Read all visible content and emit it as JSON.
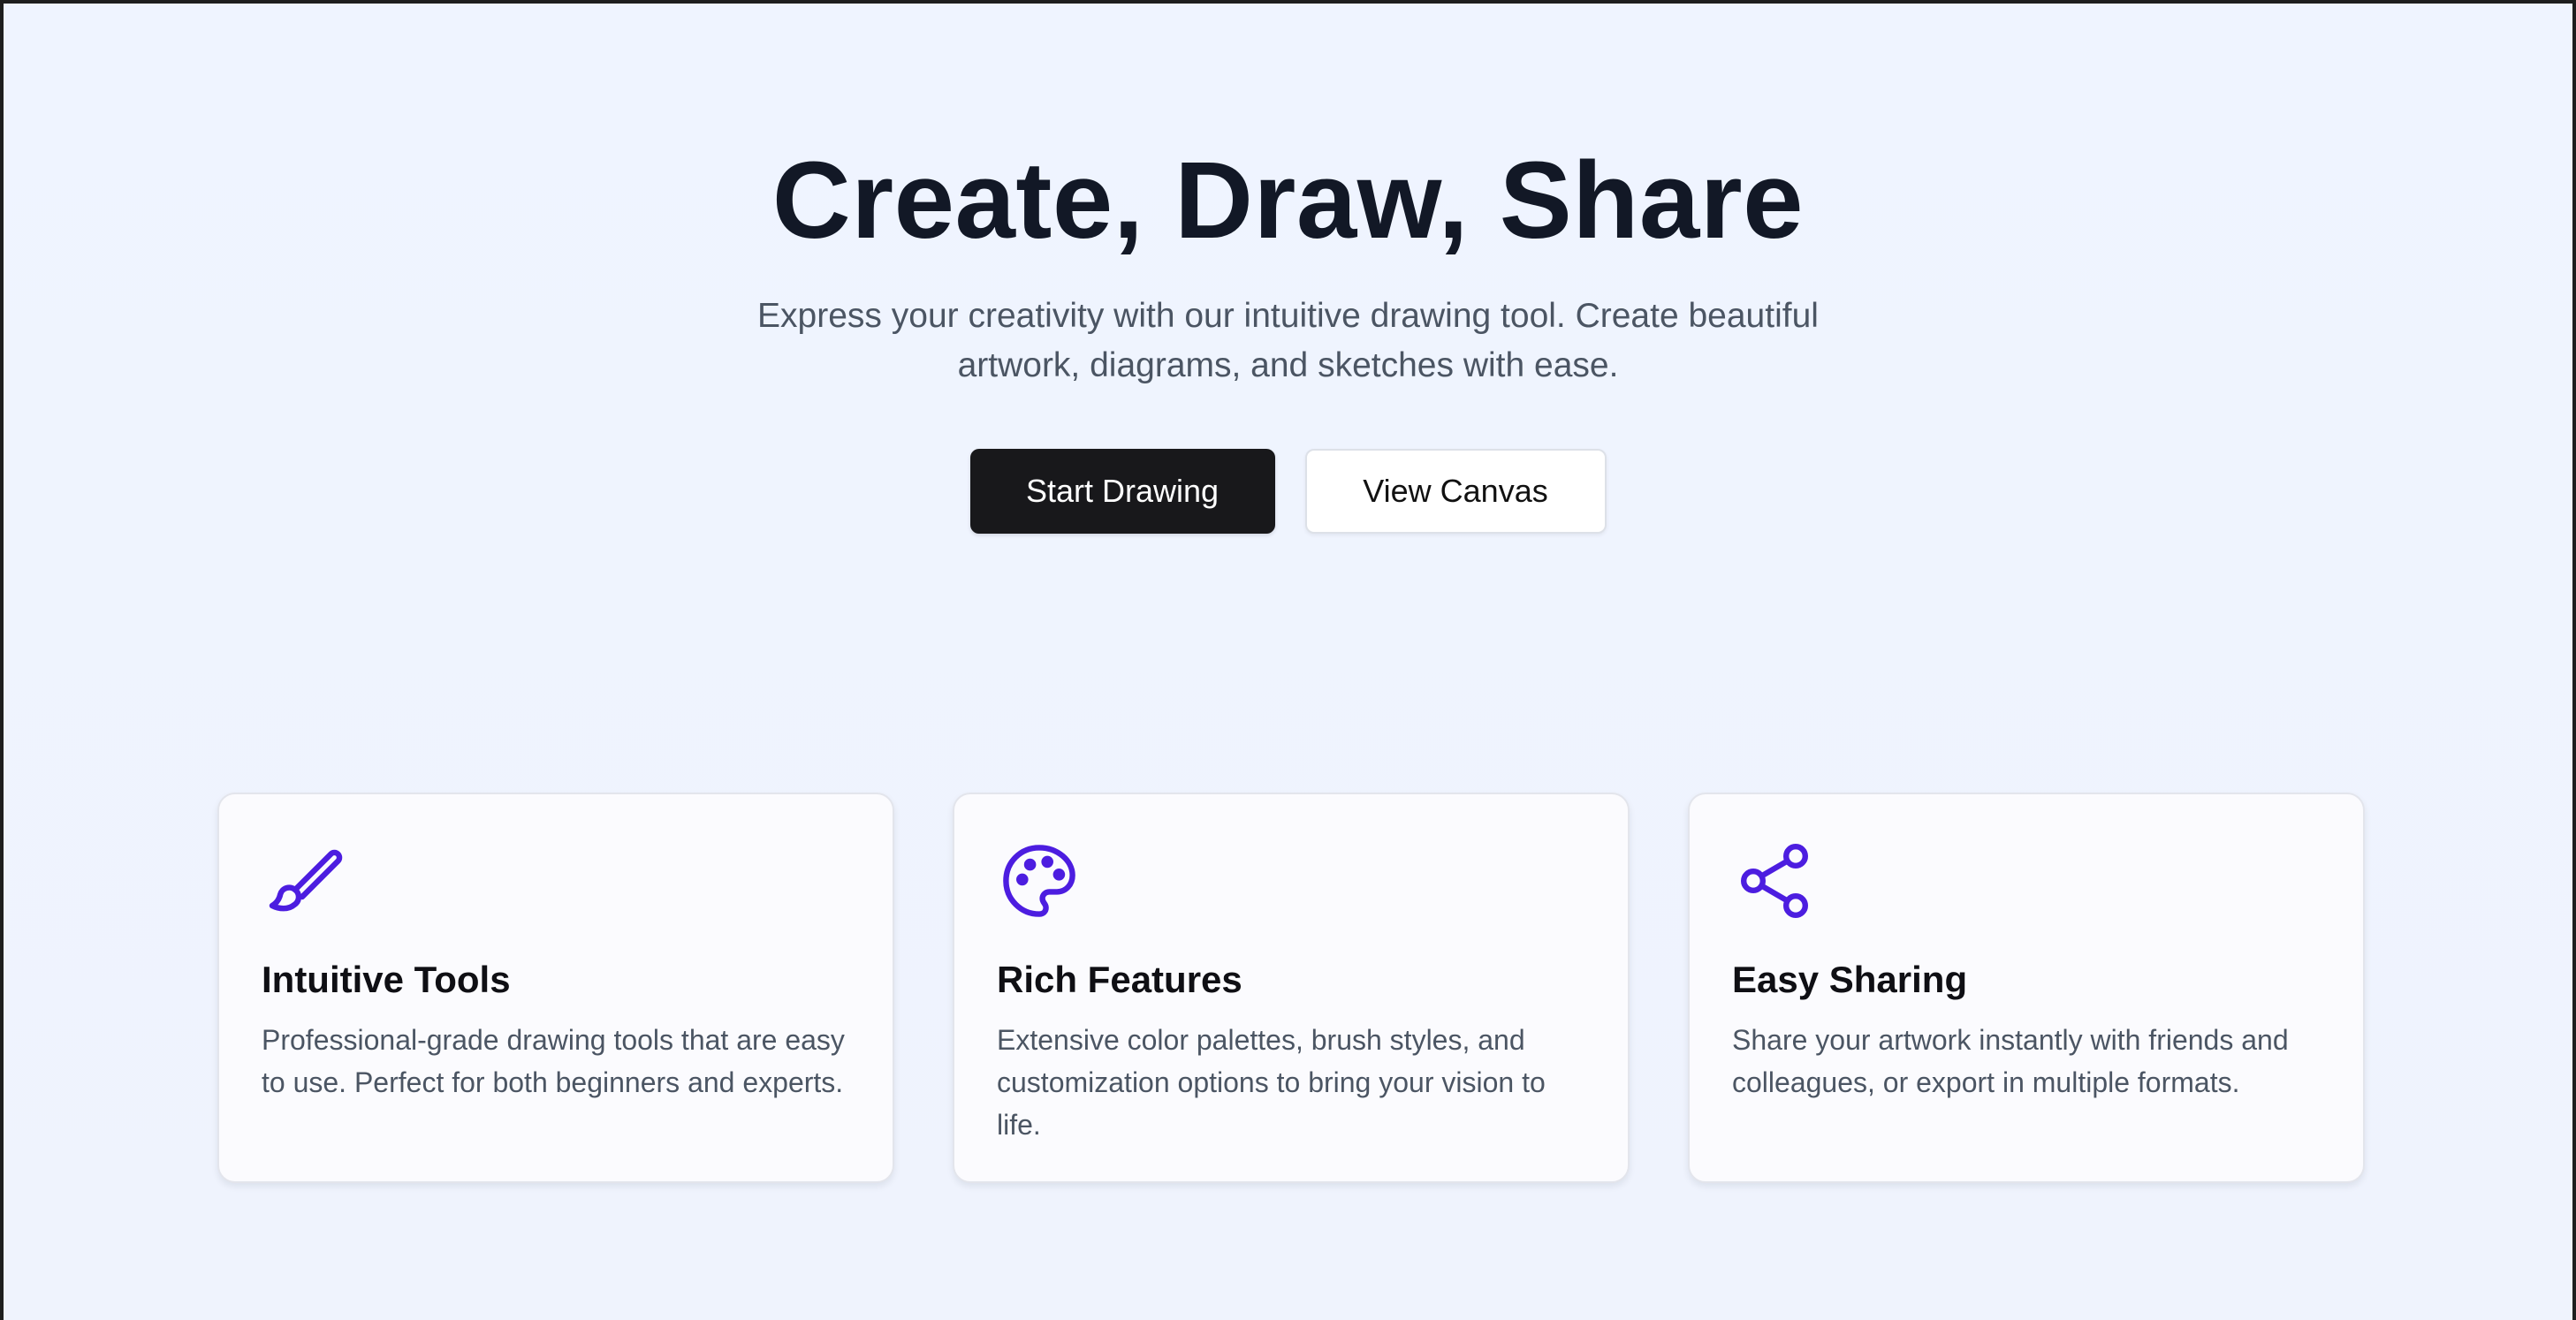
{
  "hero": {
    "title": "Create, Draw, Share",
    "subtitle": "Express your creativity with our intuitive drawing tool. Create beautiful artwork, diagrams, and sketches with ease.",
    "primary_button": "Start Drawing",
    "secondary_button": "View Canvas"
  },
  "features": [
    {
      "icon": "brush-icon",
      "title": "Intuitive Tools",
      "description": "Professional-grade drawing tools that are easy to use. Perfect for both beginners and experts."
    },
    {
      "icon": "palette-icon",
      "title": "Rich Features",
      "description": "Extensive color palettes, brush styles, and customization options to bring your vision to life."
    },
    {
      "icon": "share-icon",
      "title": "Easy Sharing",
      "description": "Share your artwork instantly with friends and colleagues, or export in multiple formats."
    }
  ],
  "colors": {
    "accent": "#4c1de0",
    "primary_button_bg": "#18181b",
    "page_bg": "#eef3fe",
    "heading": "#121826",
    "body_text": "#4b5563"
  }
}
